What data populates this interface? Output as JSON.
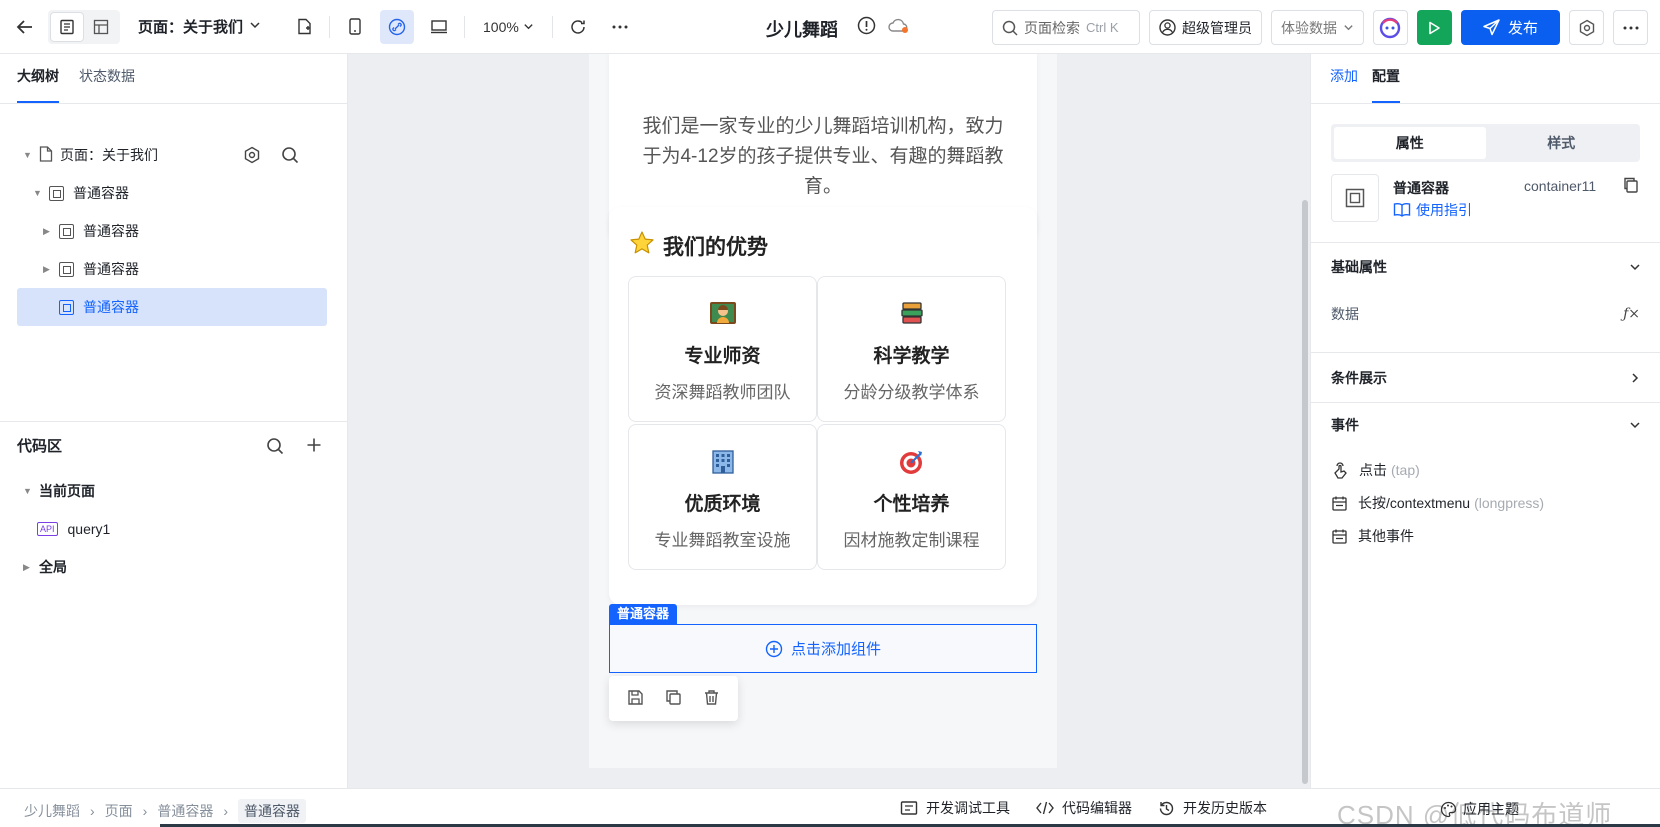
{
  "toolbar": {
    "page_select": "页面：关于我们",
    "zoom": "100%",
    "app_title": "少儿舞蹈",
    "search_placeholder": "页面检索",
    "search_shortcut": "Ctrl K",
    "user": "超级管理员",
    "data_mode": "体验数据",
    "publish": "发布"
  },
  "left": {
    "tabs": [
      "大纲树",
      "状态数据"
    ],
    "tree": {
      "page": "页面：关于我们",
      "root": "普通容器",
      "child1": "普通容器",
      "child2": "普通容器",
      "child3": "普通容器"
    },
    "code": {
      "title": "代码区",
      "current_page": "当前页面",
      "api_badge": "API",
      "query": "query1",
      "global": "全局"
    }
  },
  "canvas": {
    "intro_text": "我们是一家专业的少儿舞蹈培训机构，致力于为4-12岁的孩子提供专业、有趣的舞蹈教育。",
    "adv_title": "我们的优势",
    "features": [
      {
        "title": "专业师资",
        "desc": "资深舞蹈教师团队",
        "icon": "teacher-icon"
      },
      {
        "title": "科学教学",
        "desc": "分龄分级教学体系",
        "icon": "books-icon"
      },
      {
        "title": "优质环境",
        "desc": "专业舞蹈教室设施",
        "icon": "building-icon"
      },
      {
        "title": "个性培养",
        "desc": "因材施教定制课程",
        "icon": "target-icon"
      }
    ],
    "selected_tag": "普通容器",
    "add_component": "点击添加组件"
  },
  "right": {
    "tabs": [
      "添加",
      "配置"
    ],
    "seg": [
      "属性",
      "样式"
    ],
    "component_name": "普通容器",
    "component_id": "container11",
    "guide_link": "使用指引",
    "sections": {
      "basic": "基础属性",
      "data_label": "数据",
      "condition": "条件展示",
      "events": "事件"
    },
    "events": [
      {
        "name": "点击",
        "sub": "(tap)"
      },
      {
        "name": "长按/contextmenu",
        "sub": "(longpress)"
      },
      {
        "name": "其他事件",
        "sub": ""
      }
    ]
  },
  "bottom": {
    "crumbs": [
      "少儿舞蹈",
      "页面",
      "普通容器",
      "普通容器"
    ],
    "debug": "开发调试工具",
    "code_editor": "代码编辑器",
    "history": "开发历史版本",
    "theme": "应用主题",
    "watermark": "CSDN @低代码布道师"
  },
  "colors": {
    "primary": "#1463ff",
    "run_green": "#13a65b",
    "publish_blue": "#0a5ff0",
    "selected_bg": "#d6e3fb"
  }
}
